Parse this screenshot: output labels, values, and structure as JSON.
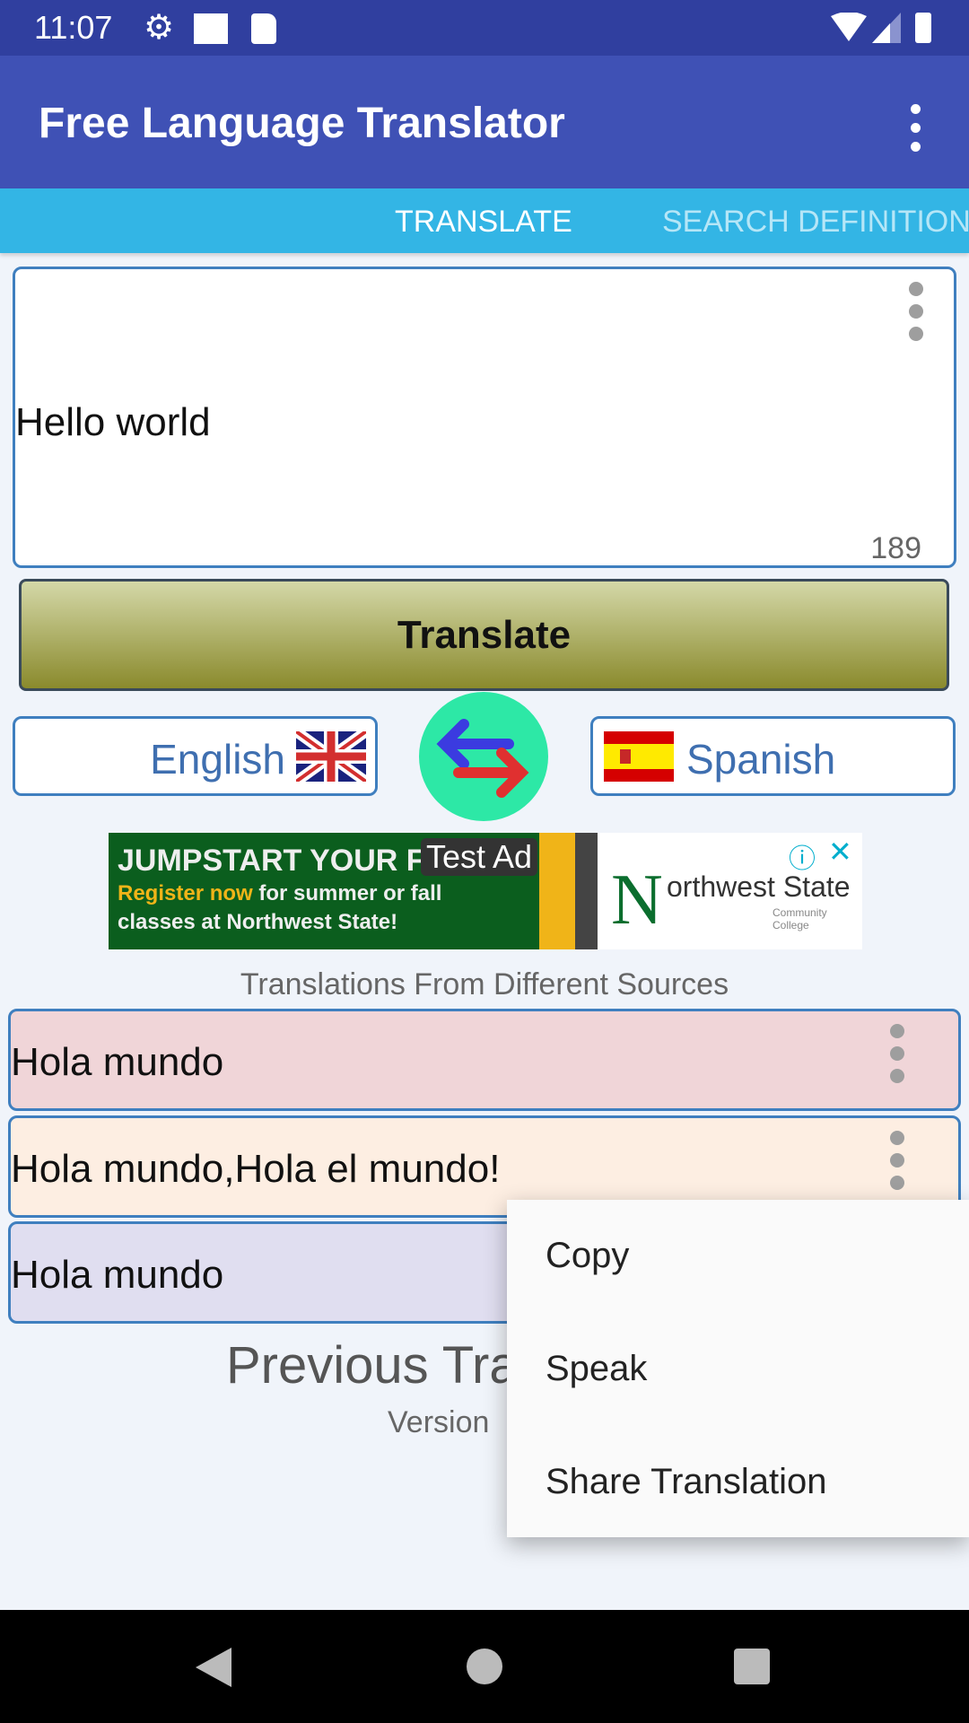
{
  "status_bar": {
    "time": "11:07"
  },
  "app_bar": {
    "title": "Free Language Translator"
  },
  "tabs": [
    {
      "label": "TRANSLATE",
      "active": true
    },
    {
      "label": "SEARCH DEFINITION",
      "active": false
    }
  ],
  "input": {
    "value": "Hello world",
    "char_count": "189"
  },
  "translate_button": {
    "label": "Translate"
  },
  "languages": {
    "source": "English",
    "target": "Spanish"
  },
  "ad": {
    "badge": "Test Ad",
    "headline": "JUMPSTART YOUR F",
    "line1_highlight": "Register now",
    "line1_rest": " for summer or fall",
    "line2": "classes at Northwest State!",
    "logo_main": "orthwest State",
    "logo_sub": "Community College"
  },
  "sources_label": "Translations From Different Sources",
  "results": [
    {
      "text": "Hola mundo",
      "color": "#f0d5d8"
    },
    {
      "text": "Hola mundo,Hola el mundo!",
      "color": "#fdeee2"
    },
    {
      "text": "Hola mundo",
      "color": "#e0def0"
    }
  ],
  "previous_label": "Previous Tra",
  "version_label": "Version",
  "context_menu": {
    "items": [
      "Copy",
      "Speak",
      "Share Translation"
    ]
  },
  "colors": {
    "primary": "#3f51b5",
    "primary_dark": "#303f9f",
    "tab_bar": "#33b5e5",
    "border": "#3f7fbf",
    "swap": "#2de8a6"
  }
}
